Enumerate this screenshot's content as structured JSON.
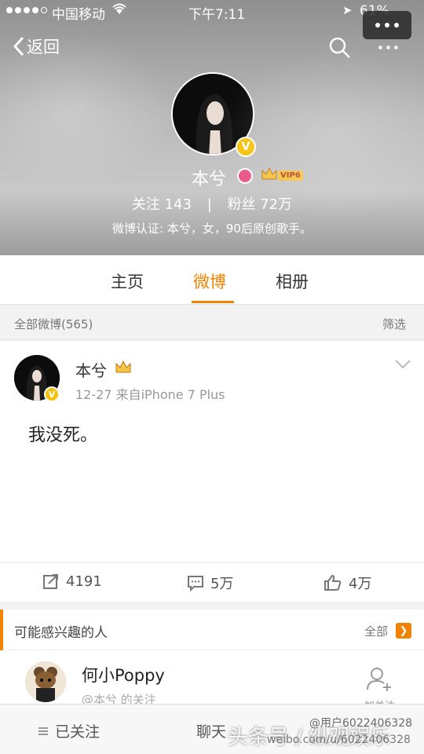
{
  "status_bar": {
    "carrier": "中国移动",
    "time": "下午7:11",
    "battery": "61%"
  },
  "nav": {
    "back_label": "返回"
  },
  "profile": {
    "name": "本兮",
    "vip_label": "VIP6",
    "following_label": "关注",
    "following_count": "143",
    "fans_label": "粉丝",
    "fans_count": "72万",
    "verification": "微博认证: 本兮，女，90后原创歌手。"
  },
  "tabs": [
    {
      "label": "主页",
      "active": false
    },
    {
      "label": "微博",
      "active": true
    },
    {
      "label": "相册",
      "active": false
    }
  ],
  "filter_bar": {
    "all_posts": "全部微博(565)",
    "filter": "筛选"
  },
  "post": {
    "author": "本兮",
    "meta": "12-27  来自iPhone 7 Plus",
    "text": "我没死。",
    "reposts": "4191",
    "comments": "5万",
    "likes": "4万"
  },
  "suggestions": {
    "title": "可能感兴趣的人",
    "all_label": "全部",
    "user_name": "何小Poppy",
    "user_sub": "@本兮 的关注",
    "follow_label": "加关注"
  },
  "bottom_bar": {
    "followed": "已关注",
    "chat": "聊天"
  },
  "watermark": {
    "main": "头条号 / 纵观娱乐",
    "handle": "@用户6022406328",
    "site": "weibo.com/u/6022406328"
  },
  "colors": {
    "accent": "#f08300",
    "verified": "#f4c20d"
  }
}
